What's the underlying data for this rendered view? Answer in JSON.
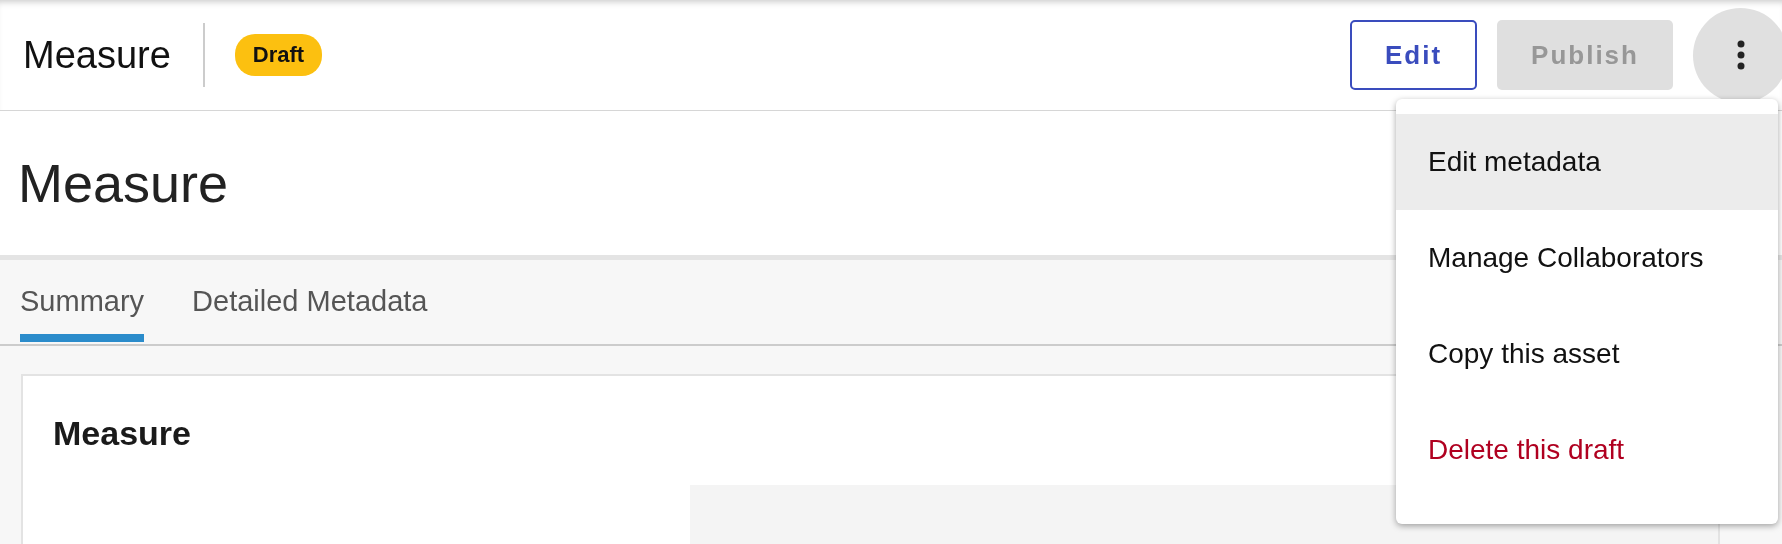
{
  "header": {
    "title": "Measure",
    "status_badge": "Draft",
    "buttons": [
      {
        "label": "Edit",
        "kind": "outlined",
        "disabled": false
      },
      {
        "label": "Publish",
        "kind": "filled",
        "disabled": true
      }
    ]
  },
  "page_title": "Measure",
  "tabs": [
    {
      "label": "Summary",
      "selected": true
    },
    {
      "label": "Detailed Metadata",
      "selected": false
    }
  ],
  "card": {
    "title": "Measure"
  },
  "menu": {
    "items": [
      {
        "label": "Edit metadata",
        "kind": "normal",
        "selected": true
      },
      {
        "label": "Manage Collaborators",
        "kind": "normal",
        "selected": false
      },
      {
        "label": "Copy this asset",
        "kind": "normal",
        "selected": false
      },
      {
        "label": "Delete this draft",
        "kind": "danger",
        "selected": false
      }
    ]
  }
}
